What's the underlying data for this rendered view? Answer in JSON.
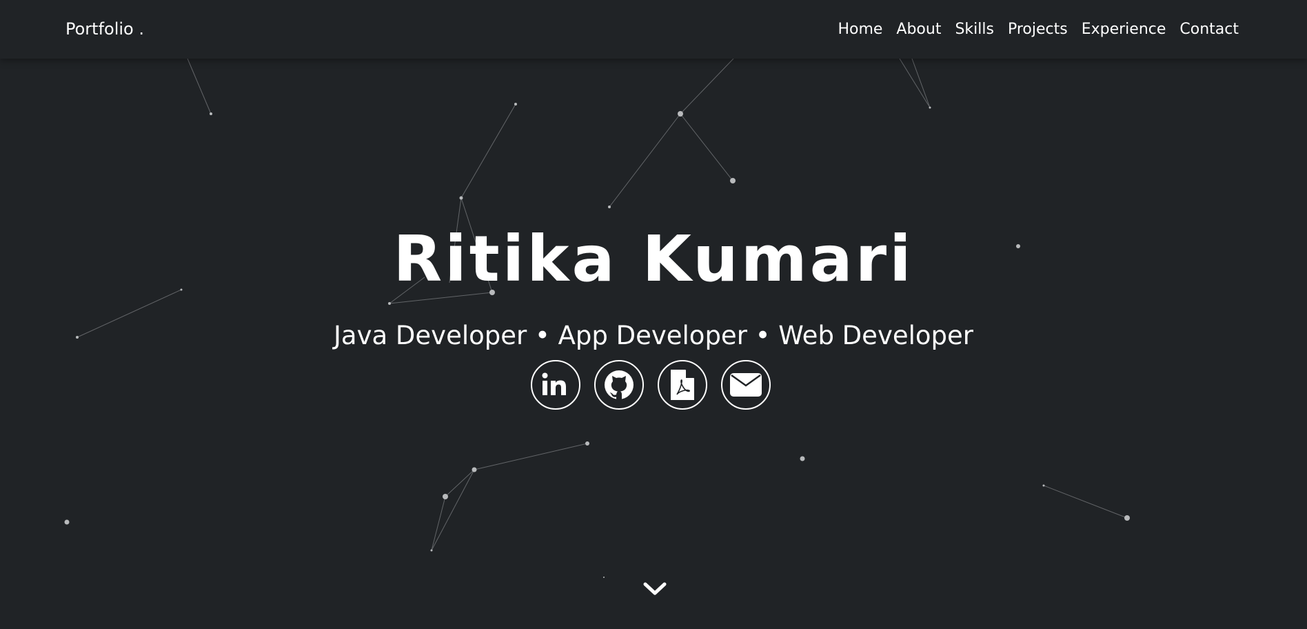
{
  "nav": {
    "brand": "Portfolio .",
    "links": [
      "Home",
      "About",
      "Skills",
      "Projects",
      "Experience",
      "Contact"
    ]
  },
  "hero": {
    "name": "Ritika Kumari",
    "roles": "Java Developer • App Developer • Web Developer",
    "social": [
      {
        "icon": "linkedin-icon"
      },
      {
        "icon": "github-icon"
      },
      {
        "icon": "pdf-file-icon"
      },
      {
        "icon": "envelope-icon"
      }
    ],
    "scroll_icon": "chevron-down-icon"
  },
  "colors": {
    "background": "#202326",
    "text": "#ffffff",
    "particle": "#b8babc",
    "particle_line": "#6a6d70"
  }
}
